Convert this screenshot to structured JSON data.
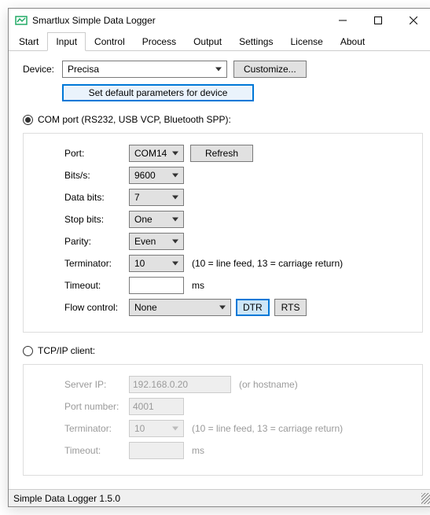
{
  "window": {
    "title": "Smartlux Simple Data Logger"
  },
  "tabs": [
    "Start",
    "Input",
    "Control",
    "Process",
    "Output",
    "Settings",
    "License",
    "About"
  ],
  "activeTab": "Input",
  "device": {
    "label": "Device:",
    "value": "Precisa",
    "customize": "Customize...",
    "setDefault": "Set default parameters for device"
  },
  "com": {
    "radio": "COM port (RS232, USB VCP, Bluetooth SPP):",
    "portLabel": "Port:",
    "portValue": "COM14",
    "refresh": "Refresh",
    "bitsLabel": "Bits/s:",
    "bitsValue": "9600",
    "dataBitsLabel": "Data bits:",
    "dataBitsValue": "7",
    "stopBitsLabel": "Stop bits:",
    "stopBitsValue": "One",
    "parityLabel": "Parity:",
    "parityValue": "Even",
    "terminatorLabel": "Terminator:",
    "terminatorValue": "10",
    "terminatorHint": "(10 = line feed, 13 = carriage return)",
    "timeoutLabel": "Timeout:",
    "timeoutValue": "",
    "timeoutUnit": "ms",
    "flowLabel": "Flow control:",
    "flowValue": "None",
    "dtr": "DTR",
    "rts": "RTS"
  },
  "tcp": {
    "radio": "TCP/IP client:",
    "ipLabel": "Server IP:",
    "ipValue": "192.168.0.20",
    "ipHint": "(or hostname)",
    "portLabel": "Port number:",
    "portValue": "4001",
    "terminatorLabel": "Terminator:",
    "terminatorValue": "10",
    "terminatorHint": "(10 = line feed, 13 = carriage return)",
    "timeoutLabel": "Timeout:",
    "timeoutValue": "",
    "timeoutUnit": "ms"
  },
  "status": "Simple Data Logger 1.5.0"
}
